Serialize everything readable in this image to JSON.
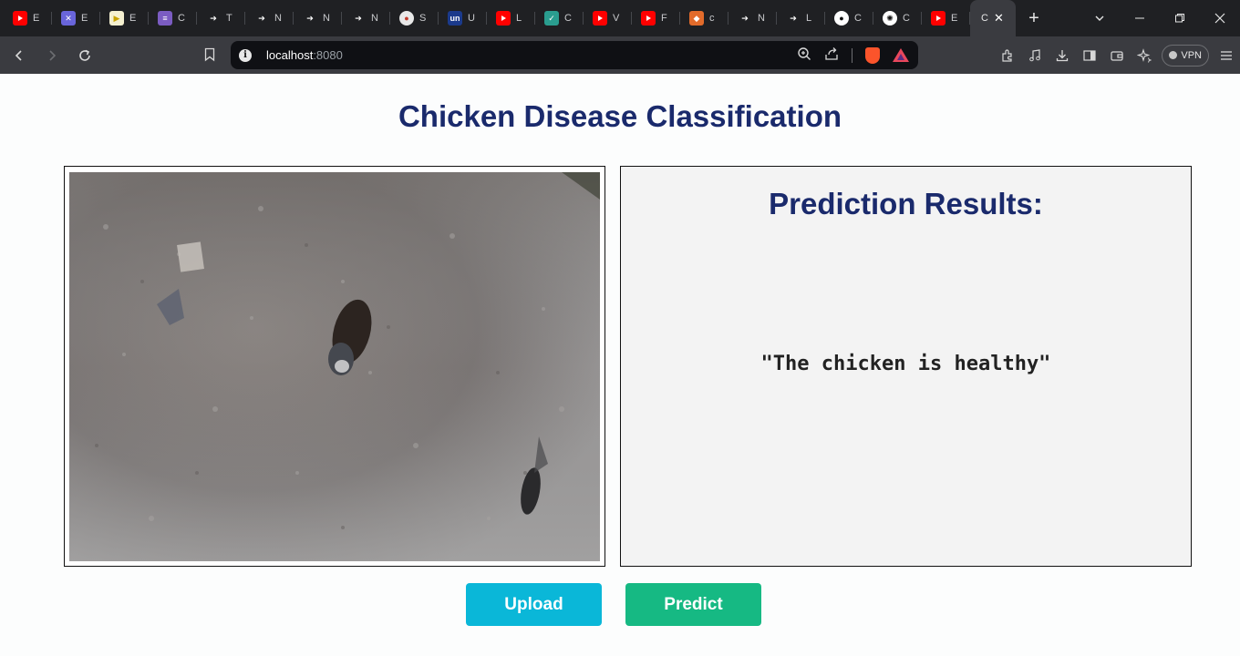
{
  "browser": {
    "tabs": [
      {
        "label": "E",
        "icon": "youtube-icon"
      },
      {
        "label": "E",
        "icon": "excalidraw-icon"
      },
      {
        "label": "E",
        "icon": "play-circle-icon"
      },
      {
        "label": "C",
        "icon": "database-icon"
      },
      {
        "label": "T",
        "icon": "arrow-logo-icon"
      },
      {
        "label": "N",
        "icon": "arrow-logo-icon"
      },
      {
        "label": "N",
        "icon": "arrow-logo-icon"
      },
      {
        "label": "N",
        "icon": "arrow-logo-icon"
      },
      {
        "label": "S",
        "icon": "panda-icon"
      },
      {
        "label": "U",
        "icon": "un-logo-icon"
      },
      {
        "label": "L",
        "icon": "youtube-icon"
      },
      {
        "label": "C",
        "icon": "check-circle-icon"
      },
      {
        "label": "V",
        "icon": "youtube-icon"
      },
      {
        "label": "F",
        "icon": "youtube-icon"
      },
      {
        "label": "c",
        "icon": "flame-icon"
      },
      {
        "label": "N",
        "icon": "arrow-logo-icon"
      },
      {
        "label": "L",
        "icon": "arrow-logo-icon"
      },
      {
        "label": "C",
        "icon": "github-icon"
      },
      {
        "label": "C",
        "icon": "openai-icon"
      },
      {
        "label": "E",
        "icon": "youtube-icon"
      }
    ],
    "active_tab": {
      "label": "C"
    },
    "url_host": "localhost",
    "url_port": ":8080",
    "vpn_label": "VPN"
  },
  "page": {
    "title": "Chicken Disease Classification",
    "results_title": "Prediction Results:",
    "result_text": "\"The chicken is healthy\"",
    "upload_label": "Upload",
    "predict_label": "Predict"
  }
}
